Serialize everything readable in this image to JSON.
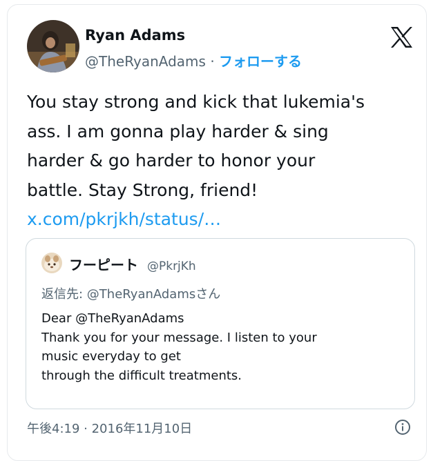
{
  "post": {
    "author": {
      "display_name": "Ryan Adams",
      "handle": "@TheRyanAdams",
      "separator": "·",
      "follow_label": "フォローする"
    },
    "text_lines": [
      "You stay strong and kick that lukemia's",
      "ass. I am gonna play harder & sing",
      "harder & go harder to honor your",
      "battle. Stay Strong, friend!"
    ],
    "link_text": "x.com/pkrjkh/status/…",
    "timestamp": "午後4:19 · 2016年11月10日",
    "icons": {
      "logo": "x-logo-icon",
      "info": "info-icon"
    }
  },
  "quoted_post": {
    "display_name": "フーピート",
    "handle": "@PkrjKh",
    "reply_to": "返信先: @TheRyanAdamsさん",
    "lines": [
      "Dear @TheRyanAdams",
      "Thank you for your message. I listen to your",
      "music everyday to get",
      "through the difficult treatments."
    ]
  },
  "colors": {
    "link": "#1d9bf0",
    "text": "#0f1419",
    "secondary": "#536471",
    "border": "#cfd9de"
  }
}
